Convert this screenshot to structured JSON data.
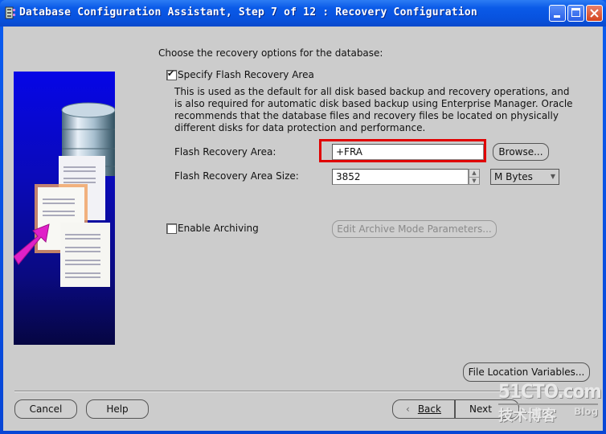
{
  "window": {
    "title": "Database Configuration Assistant, Step 7 of 12 : Recovery Configuration",
    "icon": "app-icon",
    "controls": {
      "minimize": "_",
      "maximize": "□",
      "close": "✕"
    }
  },
  "main": {
    "intro": "Choose the recovery options for the database:",
    "flash_recovery": {
      "checkbox_label": "Specify Flash Recovery Area",
      "checked": true,
      "description": "This is used as the default for all disk based backup and recovery operations, and is also required for automatic disk based backup using Enterprise Manager. Oracle recommends that the database files and recovery files be located on physically different disks for data protection and performance.",
      "area_label": "Flash Recovery Area:",
      "area_value": "+FRA",
      "browse_label": "Browse...",
      "size_label": "Flash Recovery Area Size:",
      "size_value": "3852",
      "unit_selected": "M Bytes"
    },
    "archiving": {
      "checkbox_label": "Enable Archiving",
      "checked": false,
      "edit_params_label": "Edit Archive Mode Parameters..."
    },
    "file_location_label": "File Location Variables..."
  },
  "footer": {
    "cancel": "Cancel",
    "help": "Help",
    "back": "Back",
    "next": "Next"
  },
  "watermark": {
    "site": "51CTO.com",
    "subtitle": "技术博客",
    "blog": "Blog"
  },
  "colors": {
    "titlebar": "#0a5ae8",
    "client_bg": "#cccccc",
    "highlight": "#e00000"
  }
}
